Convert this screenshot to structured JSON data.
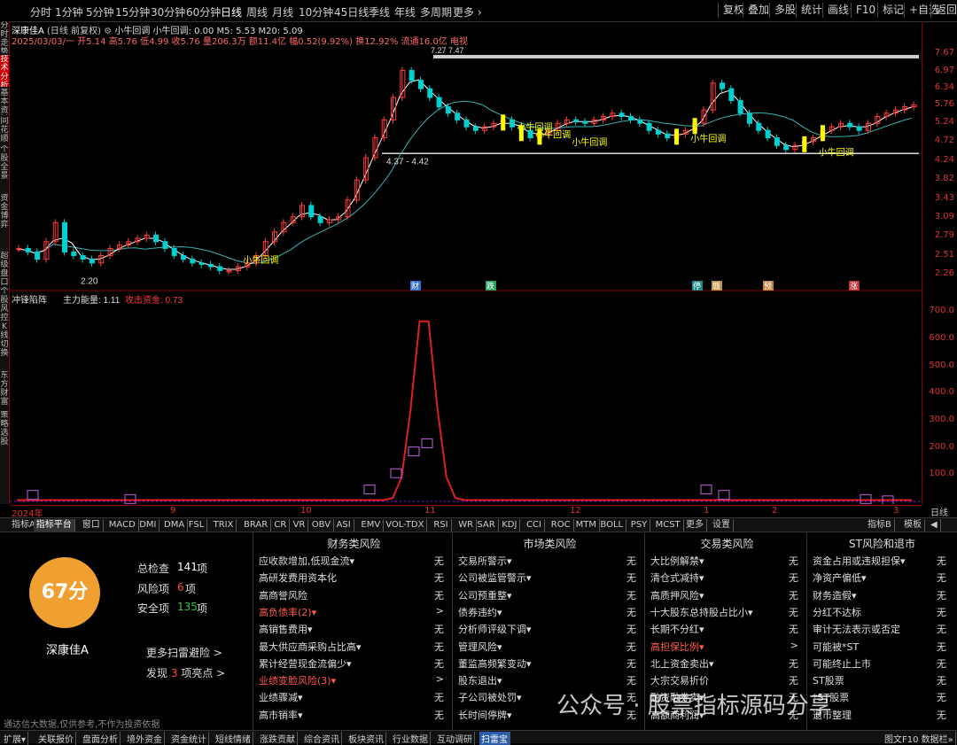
{
  "toolbar": {
    "periods": [
      "分时",
      "1分钟",
      "5分钟",
      "15分钟",
      "30分钟",
      "60分钟",
      "日线",
      "周线",
      "月线",
      "10分钟",
      "45日线",
      "季线",
      "年线",
      "多周期",
      "更多 ›"
    ],
    "active_period": "日线",
    "right_items": [
      "复权",
      "叠加",
      "多股",
      "统计",
      "画线",
      "F10",
      "标记",
      "+自选",
      "返回"
    ]
  },
  "side_tabs": [
    "分时走势",
    "技术分析",
    "基本资料",
    "同花顺F10",
    "个股全景",
    "资金博弈",
    "超级盘口",
    "个股风控",
    "K线切换",
    "东方财富",
    "策略选股"
  ],
  "side_tab_active": "技术分析",
  "chart": {
    "title": "深康佳A",
    "title_suffix": "(日线 前复权)",
    "indicator_name": "小牛回调",
    "indicator_values": "小牛回调: 0.00  M5: 5.53  M20: 5.09",
    "info": "2025/03/03/一  开5.14  高5.76  低4.99  收5.76  量206.3万  额11.4亿  幅0.52(9.92%)  换12.92%  流通16.0亿  电视",
    "price_labels": [
      "7.67",
      "6.97",
      "6.34",
      "5.76",
      "5.24",
      "4.72",
      "4.24",
      "3.82",
      "3.43",
      "3.09",
      "2.79",
      "2.51",
      "2.26"
    ],
    "range_label": "4.37 - 4.42",
    "low_label": "2.20",
    "high_label": "7.27 7.47",
    "signal_label": "小牛回调",
    "event_tags": [
      "财",
      "跌",
      "停",
      "赣",
      "预",
      "涨"
    ],
    "event_colors": [
      "#2f6fd0",
      "#2aa060",
      "#1e8c8c",
      "#c09040",
      "#c08040",
      "#c03030"
    ],
    "sub_indicator_name": "冲锋陷阵",
    "sub_val1": "主力能量: 1.11",
    "sub_val2": "攻击资金: 0.73",
    "sub_labels": [
      "700.0",
      "600.0",
      "500.0",
      "400.0",
      "300.0",
      "200.0",
      "100.0"
    ],
    "dates": [
      "2024年",
      "9",
      "10",
      "11",
      "12",
      "1",
      "2",
      "3"
    ],
    "date_right": "日线"
  },
  "indicator_tabs": [
    "指标A",
    "指标平台",
    "窗口",
    "MACD",
    "DMI",
    "DMA",
    "FSL",
    "TRIX",
    "BRAR",
    "CR",
    "VR",
    "OBV",
    "ASI",
    "EMV",
    "VOL-TDX",
    "RSI",
    "WR",
    "SAR",
    "KDJ",
    "CCI",
    "ROC",
    "MTM",
    "BOLL",
    "PSY",
    "MCST",
    "更多",
    "设置"
  ],
  "indicator_tabs_right": [
    "指标B",
    "模板",
    "◀"
  ],
  "panel": {
    "score": "67分",
    "stock_name": "深康佳A",
    "total_label": "总检查",
    "total_value": "141",
    "risk_label": "风险项",
    "risk_value": "6",
    "safe_label": "安全项",
    "safe_value": "135",
    "unit": "项",
    "more_link": "更多扫雷避险 >",
    "found_prefix": "发现",
    "found_count": "3",
    "found_suffix": "项亮点 >",
    "disclaimer": "通达信大数据,仅供参考,不作为投资依据",
    "categories": [
      {
        "title": "财务类风险",
        "items": [
          {
            "label": "应收款增加,低现金流▾",
            "value": "无",
            "hl": false
          },
          {
            "label": "高研发费用资本化",
            "value": "无",
            "hl": false
          },
          {
            "label": "高商誉风险",
            "value": "无",
            "hl": false
          },
          {
            "label": "高负债率(2)▾",
            "value": ">",
            "hl": true
          },
          {
            "label": "高销售费用▾",
            "value": "无",
            "hl": false
          },
          {
            "label": "最大供应商采购占比高▾",
            "value": "无",
            "hl": false
          },
          {
            "label": "累计经营现金流偏少▾",
            "value": "无",
            "hl": false
          },
          {
            "label": "业绩变脸风险(3)▾",
            "value": ">",
            "hl": true
          },
          {
            "label": "业绩骤减▾",
            "value": "无",
            "hl": false
          },
          {
            "label": "高市销率▾",
            "value": "无",
            "hl": false
          }
        ]
      },
      {
        "title": "市场类风险",
        "items": [
          {
            "label": "交易所警示▾",
            "value": "无",
            "hl": false
          },
          {
            "label": "公司被监管警示▾",
            "value": "无",
            "hl": false
          },
          {
            "label": "公司预重整▾",
            "value": "无",
            "hl": false
          },
          {
            "label": "债券违约▾",
            "value": "无",
            "hl": false
          },
          {
            "label": "分析师评级下调▾",
            "value": "无",
            "hl": false
          },
          {
            "label": "管理风险▾",
            "value": "无",
            "hl": false
          },
          {
            "label": "董监高频繁变动▾",
            "value": "无",
            "hl": false
          },
          {
            "label": "股东退出▾",
            "value": "无",
            "hl": false
          },
          {
            "label": "子公司被处罚▾",
            "value": "无",
            "hl": false
          },
          {
            "label": "长时间停牌▾",
            "value": "无",
            "hl": false
          }
        ]
      },
      {
        "title": "交易类风险",
        "items": [
          {
            "label": "大比例解禁▾",
            "value": "无",
            "hl": false
          },
          {
            "label": "清仓式减持▾",
            "value": "无",
            "hl": false
          },
          {
            "label": "高质押风险▾",
            "value": "无",
            "hl": false
          },
          {
            "label": "十大股东总持股占比小▾",
            "value": "无",
            "hl": false
          },
          {
            "label": "长期不分红▾",
            "value": "无",
            "hl": false
          },
          {
            "label": "高担保比例▾",
            "value": ">",
            "hl": true
          },
          {
            "label": "北上资金卖出▾",
            "value": "无",
            "hl": false
          },
          {
            "label": "大宗交易折价",
            "value": "无",
            "hl": false
          },
          {
            "label": "融资融券卖▾",
            "value": "无",
            "hl": false
          },
          {
            "label": "高额商利润▾",
            "value": "无",
            "hl": false
          }
        ]
      },
      {
        "title": "ST风险和退市",
        "items": [
          {
            "label": "资金占用或违规担保▾",
            "value": "无",
            "hl": false
          },
          {
            "label": "净资产偏低▾",
            "value": "无",
            "hl": false
          },
          {
            "label": "财务造假▾",
            "value": "无",
            "hl": false
          },
          {
            "label": "分红不达标",
            "value": "无",
            "hl": false
          },
          {
            "label": "审计无法表示或否定",
            "value": "无",
            "hl": false
          },
          {
            "label": "可能被*ST",
            "value": "无",
            "hl": false
          },
          {
            "label": "可能终止上市",
            "value": "无",
            "hl": false
          },
          {
            "label": "ST股票",
            "value": "无",
            "hl": false
          },
          {
            "label": "*ST股票",
            "value": "无",
            "hl": false
          },
          {
            "label": "退市整理",
            "value": "无",
            "hl": false
          }
        ]
      }
    ]
  },
  "bottom_tabs": [
    "扩展▾",
    "关联报价",
    "盘面分析",
    "境外资金",
    "资金统计",
    "短线情绪",
    "涨跌贡献",
    "综合资讯",
    "板块资讯",
    "行业数据",
    "互动调研",
    "扫雷宝"
  ],
  "bottom_active": "扫雷宝",
  "bottom_right": "图文F10  数据栏»",
  "watermark": "公众号 · 股票指标源码分享",
  "colors": {
    "up": "#ff3b3b",
    "down": "#00d0d0",
    "ma5": "#ffffff",
    "ma20": "#39b3b3",
    "signal": "#ffff00",
    "main_line": "#e02020",
    "bars": "#c060e0",
    "score": "#f0a030",
    "highlight": "#ff5a4a"
  }
}
